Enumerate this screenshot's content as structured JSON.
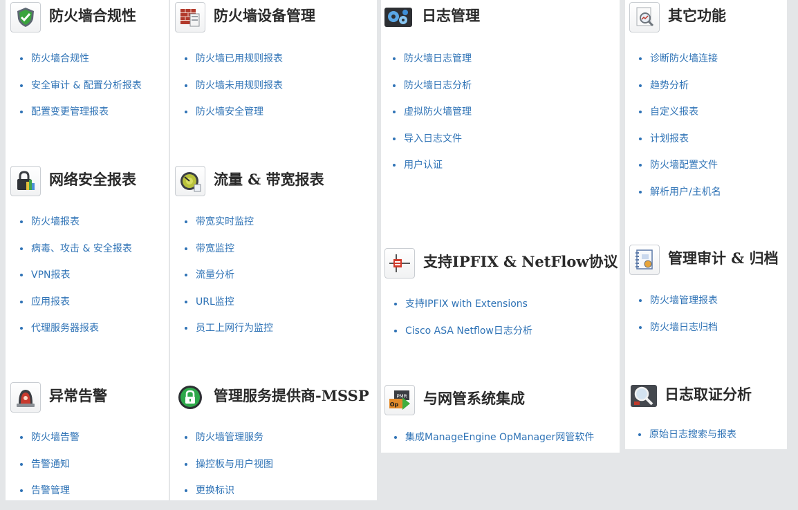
{
  "sections": {
    "compliance": {
      "title": "防火墙合规性",
      "icon": "shield-check-icon",
      "items": [
        "防火墙合规性",
        "安全审计 & 配置分析报表",
        "配置变更管理报表"
      ]
    },
    "device": {
      "title": "防火墙设备管理",
      "icon": "firewall-bricks-icon",
      "items": [
        "防火墙已用规则报表",
        "防火墙未用规则报表",
        "防火墙安全管理"
      ]
    },
    "logmgmt": {
      "title": "日志管理",
      "icon": "gears-icon",
      "items": [
        "防火墙日志管理",
        "防火墙日志分析",
        "虚拟防火墙管理",
        "导入日志文件",
        "用户认证"
      ]
    },
    "other": {
      "title": "其它功能",
      "icon": "magnifier-chart-icon",
      "items": [
        "诊断防火墙连接",
        "趋势分析",
        "自定义报表",
        "计划报表",
        "防火墙配置文件",
        "解析用户/主机名"
      ]
    },
    "netsec": {
      "title": "网络安全报表",
      "icon": "lock-report-icon",
      "items": [
        "防火墙报表",
        "病毒、攻击 & 安全报表",
        "VPN报表",
        "应用报表",
        "代理服务器报表"
      ]
    },
    "traffic": {
      "title": "流量 & 带宽报表",
      "icon": "speedometer-icon",
      "items": [
        "带宽实时监控",
        "带宽监控",
        "流量分析",
        "URL监控",
        "员工上网行为监控"
      ]
    },
    "ipfix": {
      "title": "支持IPFIX & NetFlow协议",
      "icon": "network-flow-icon",
      "items": [
        "支持IPFIX with Extensions",
        "Cisco ASA Netflow日志分析"
      ]
    },
    "audit": {
      "title": "管理审计 & 归档",
      "icon": "notebook-audit-icon",
      "items": [
        "防火墙管理报表",
        "防火墙日志归档"
      ]
    },
    "alarm": {
      "title": "异常告警",
      "icon": "alarm-siren-icon",
      "items": [
        "防火墙告警",
        "告警通知",
        "告警管理"
      ]
    },
    "mssp": {
      "title": "管理服务提供商-MSSP",
      "icon": "green-lock-icon",
      "items": [
        "防火墙管理服务",
        "操控板与用户视图",
        "更换标识"
      ]
    },
    "nms": {
      "title": "与网管系统集成",
      "icon": "opmanager-icon",
      "icon_text_top": "PMR",
      "icon_text_bottom": "Op",
      "items": [
        "集成ManageEngine OpManager网管软件"
      ]
    },
    "forensics": {
      "title": "日志取证分析",
      "icon": "forensics-magnifier-icon",
      "items": [
        "原始日志搜索与报表"
      ]
    }
  },
  "colors": {
    "link": "#2f73b6",
    "title": "#2a2a2a",
    "background": "#e4e6e8",
    "panel": "#ffffff"
  }
}
